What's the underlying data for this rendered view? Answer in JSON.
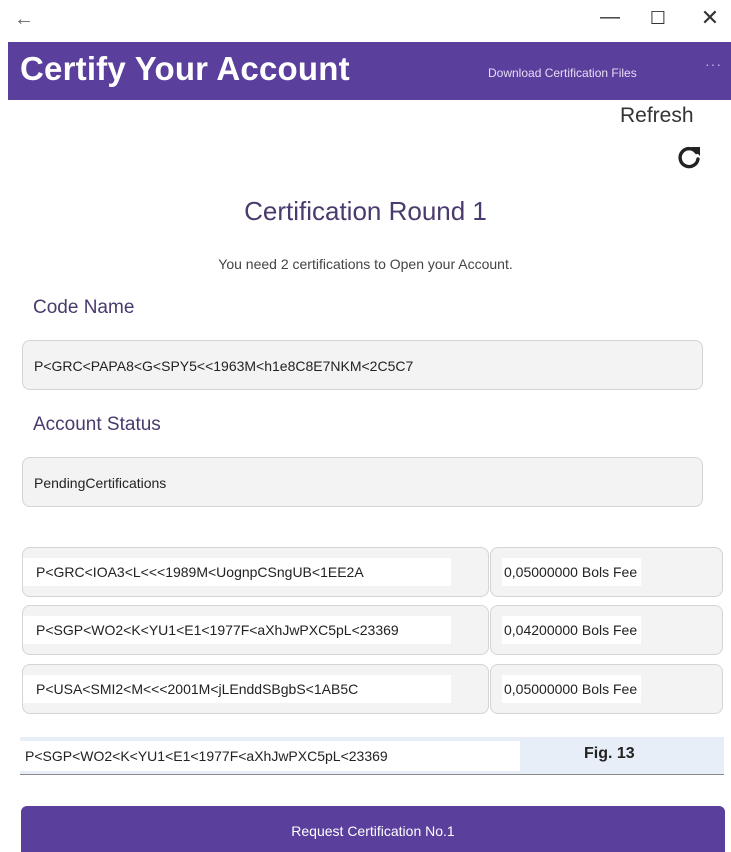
{
  "window": {
    "back_glyph": "←",
    "minimize_glyph": "—",
    "maximize_glyph": "☐",
    "close_glyph": "✕"
  },
  "appbar": {
    "title": "Certify Your Account",
    "download_label": "Download Certification Files",
    "more_glyph": "···",
    "background": "#5a3f9c"
  },
  "refresh": {
    "label": "Refresh",
    "icon": "refresh-icon"
  },
  "main": {
    "round_title": "Certification Round 1",
    "subtitle": "You need 2 certifications to Open your Account.",
    "code_name_label": "Code Name",
    "code_name_value": "P<GRC<PAPA8<G<SPY5<<1963M<h1e8C8E7NKM<2C5C7",
    "account_status_label": "Account Status",
    "account_status_value": "PendingCertifications"
  },
  "certifications": [
    {
      "code": "P<GRC<IOA3<L<<<1989M<UognpCSngUB<1EE2A",
      "fee": "0,05000000 Bols Fee"
    },
    {
      "code": "P<SGP<WO2<K<YU1<E1<1977F<aXhJwPXC5pL<23369",
      "fee": "0,04200000 Bols Fee"
    },
    {
      "code": "P<USA<SMI2<M<<<2001M<jLEnddSBgbS<1AB5C",
      "fee": "0,05000000 Bols Fee"
    }
  ],
  "selected": {
    "code": "P<SGP<WO2<K<YU1<E1<1977F<aXhJwPXC5pL<23369",
    "figure_label": "Fig. 13"
  },
  "request_button": {
    "label": "Request Certification No.1"
  }
}
